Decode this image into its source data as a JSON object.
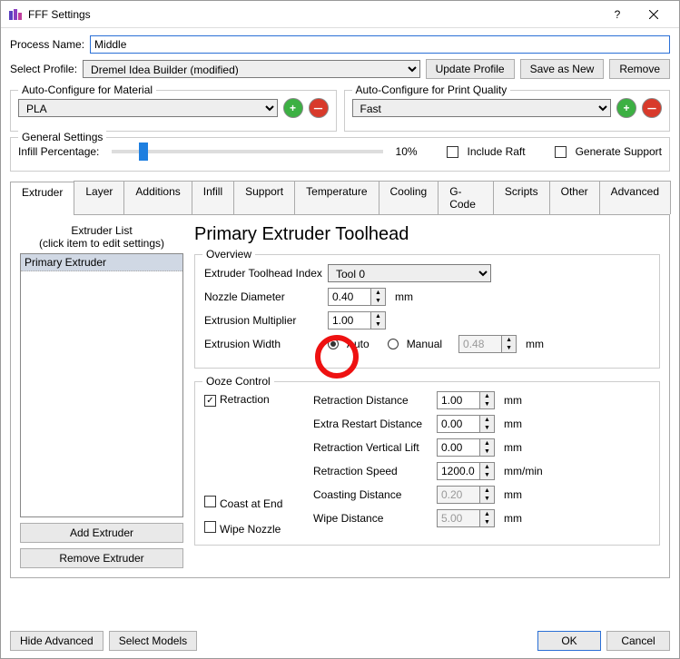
{
  "window": {
    "title": "FFF Settings"
  },
  "processName": {
    "label": "Process Name:",
    "value": "Middle"
  },
  "profile": {
    "label": "Select Profile:",
    "value": "Dremel Idea Builder (modified)",
    "update": "Update Profile",
    "saveNew": "Save as New",
    "remove": "Remove"
  },
  "material": {
    "legend": "Auto-Configure for Material",
    "value": "PLA"
  },
  "quality": {
    "legend": "Auto-Configure for Print Quality",
    "value": "Fast"
  },
  "general": {
    "legend": "General Settings",
    "infillLabel": "Infill Percentage:",
    "infillValue": "10%",
    "raft": "Include Raft",
    "support": "Generate Support"
  },
  "tabs": [
    "Extruder",
    "Layer",
    "Additions",
    "Infill",
    "Support",
    "Temperature",
    "Cooling",
    "G-Code",
    "Scripts",
    "Other",
    "Advanced"
  ],
  "extruderList": {
    "header": "Extruder List",
    "hint": "(click item to edit settings)",
    "items": [
      "Primary Extruder"
    ],
    "add": "Add Extruder",
    "remove": "Remove Extruder"
  },
  "panel": {
    "title": "Primary Extruder Toolhead",
    "overview": {
      "legend": "Overview",
      "toolIndexLabel": "Extruder Toolhead Index",
      "toolIndexValue": "Tool 0",
      "nozzleLabel": "Nozzle Diameter",
      "nozzleValue": "0.40",
      "multLabel": "Extrusion Multiplier",
      "multValue": "1.00",
      "widthLabel": "Extrusion Width",
      "auto": "Auto",
      "manual": "Manual",
      "manualValue": "0.48",
      "mm": "mm"
    },
    "ooze": {
      "legend": "Ooze Control",
      "retraction": "Retraction",
      "coast": "Coast at End",
      "wipe": "Wipe Nozzle",
      "retractDistLabel": "Retraction Distance",
      "retractDist": "1.00",
      "extraRestartLabel": "Extra Restart Distance",
      "extraRestart": "0.00",
      "vliftLabel": "Retraction Vertical Lift",
      "vlift": "0.00",
      "speedLabel": "Retraction Speed",
      "speed": "1200.0",
      "coastDistLabel": "Coasting Distance",
      "coastDist": "0.20",
      "wipeDistLabel": "Wipe Distance",
      "wipeDist": "5.00",
      "mm": "mm",
      "mmmin": "mm/min"
    }
  },
  "footer": {
    "hideAdv": "Hide Advanced",
    "selectModels": "Select Models",
    "ok": "OK",
    "cancel": "Cancel"
  }
}
